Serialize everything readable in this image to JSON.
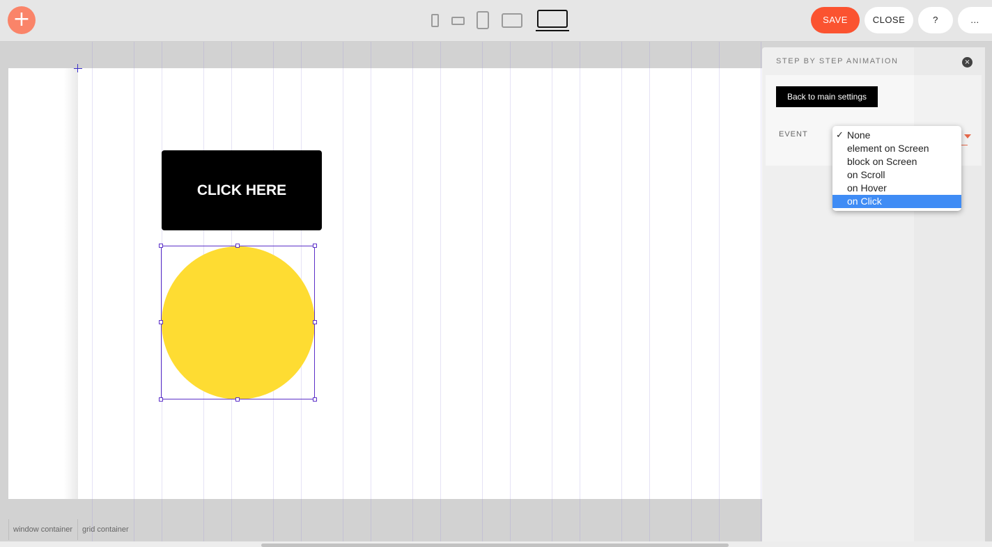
{
  "toolbar": {
    "add_symbol": "+",
    "save_label": "SAVE",
    "close_label": "CLOSE",
    "help_label": "?",
    "more_label": "...",
    "device_icons": [
      "phone-portrait-icon",
      "phone-landscape-icon",
      "tablet-portrait-icon",
      "tablet-landscape-icon",
      "laptop-icon"
    ],
    "active_device": "laptop-icon",
    "save_color": "#fb5330",
    "add_color": "#fa8469"
  },
  "canvas": {
    "button_text": "CLICK HERE",
    "circle_color": "#fedc32",
    "selection_color": "#5b2fc8"
  },
  "breadcrumbs": [
    "window container",
    "grid container"
  ],
  "panel": {
    "title": "STEP BY STEP ANIMATION",
    "close_symbol": "×",
    "back_button": "Back to main settings",
    "event_label": "EVENT",
    "event_options": [
      "None",
      "element on Screen",
      "block on Screen",
      "on Scroll",
      "on Hover",
      "on Click"
    ],
    "checked_option": "None",
    "highlighted_option": "on Click",
    "check_symbol": "✓",
    "highlight_color": "#3f8cf5",
    "accent_color": "#ea6b4c"
  }
}
